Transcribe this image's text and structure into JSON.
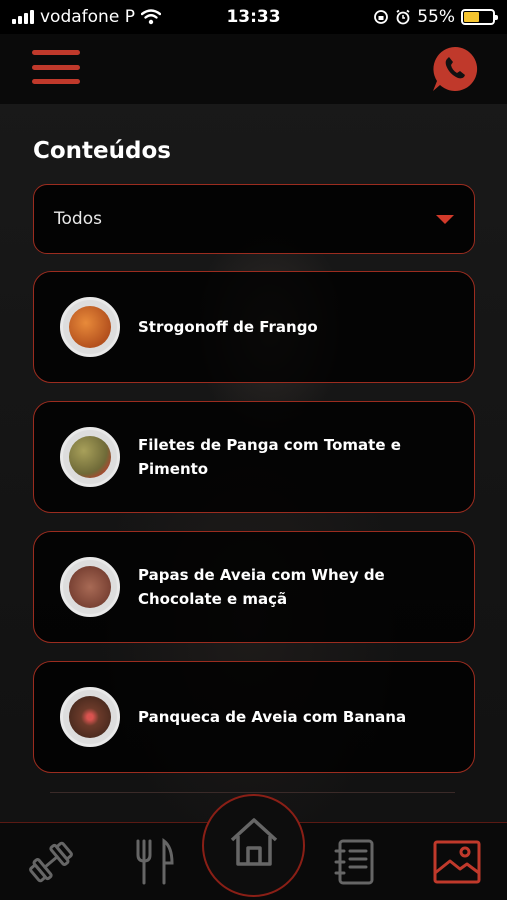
{
  "status": {
    "carrier": "vodafone P",
    "time": "13:33",
    "battery": "55%",
    "battery_level": 0.55
  },
  "page": {
    "title": "Conteúdos"
  },
  "filter": {
    "value": "Todos"
  },
  "items": [
    {
      "title": "Strogonoff de Frango",
      "food_color": "#d2691e"
    },
    {
      "title": "Filetes de Panga com Tomate e Pimento",
      "food_color": "#9a8a4a"
    },
    {
      "title": "Papas de Aveia com Whey de Chocolate e maçã",
      "food_color": "#8b4a3a"
    },
    {
      "title": "Panqueca de Aveia com Banana",
      "food_color": "#6b3a2a"
    }
  ],
  "colors": {
    "accent": "#c0392b",
    "border": "#9b2c1f",
    "battery": "#f4c430"
  },
  "tabs": [
    {
      "icon": "dumbbell-icon"
    },
    {
      "icon": "fork-knife-icon"
    },
    {
      "icon": "home-icon"
    },
    {
      "icon": "notes-icon"
    },
    {
      "icon": "gallery-icon"
    }
  ]
}
